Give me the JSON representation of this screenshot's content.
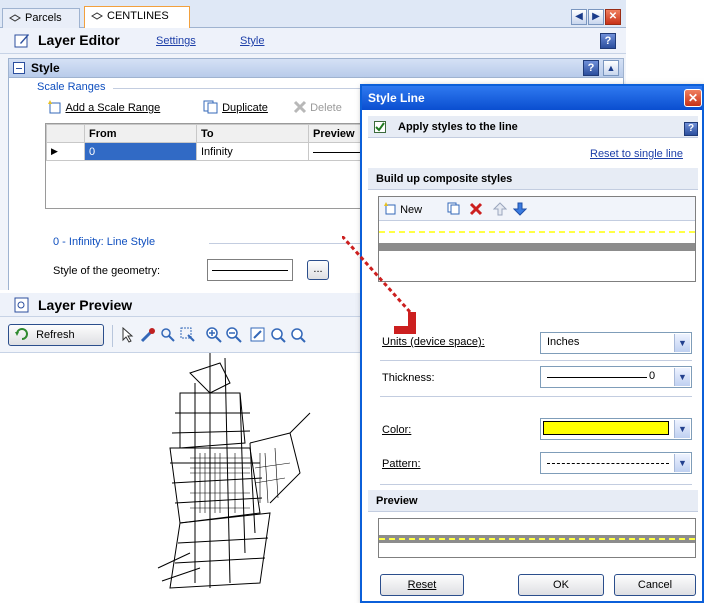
{
  "tabs": [
    {
      "label": "Parcels"
    },
    {
      "label": "CENTLINES"
    }
  ],
  "layer_editor": {
    "title": "Layer Editor",
    "links": [
      "Settings",
      "Style"
    ],
    "style_section": "Style",
    "scale_ranges_label": "Scale Ranges",
    "toolbar": {
      "add": "Add a Scale Range",
      "duplicate": "Duplicate",
      "delete": "Delete"
    },
    "table": {
      "columns": [
        "From",
        "To",
        "Preview"
      ],
      "rows": [
        {
          "from": "0",
          "to": "Infinity"
        }
      ]
    },
    "line_style_group": "0 - Infinity: Line Style",
    "style_geometry_label": "Style of the geometry:",
    "ellipsis": "..."
  },
  "layer_preview": {
    "title": "Layer Preview",
    "refresh": "Refresh"
  },
  "dialog": {
    "title": "Style Line",
    "apply_label": "Apply styles to the line",
    "apply_checked": true,
    "reset_single": "Reset to single line",
    "composite_section": "Build up composite styles",
    "new_label": "New",
    "units_label": "Units (device space):",
    "units_value": "Inches",
    "thickness_label": "Thickness:",
    "thickness_value": "0",
    "color_label": "Color:",
    "color_value": "#ffff00",
    "pattern_label": "Pattern:",
    "preview_section": "Preview",
    "buttons": {
      "reset": "Reset",
      "ok": "OK",
      "cancel": "Cancel"
    },
    "help": "?"
  },
  "colors": {
    "accent": "#0a4ed0",
    "tab_highlight": "#f2a03d",
    "selection": "#316ac5",
    "annotation_red": "#cc1f1f",
    "line_yellow": "#ffff00"
  },
  "icons": {
    "tab": "diamond-icon",
    "nav_prev": "chevron-left-icon",
    "nav_next": "chevron-right-icon",
    "close": "close-icon",
    "help": "help-icon"
  }
}
